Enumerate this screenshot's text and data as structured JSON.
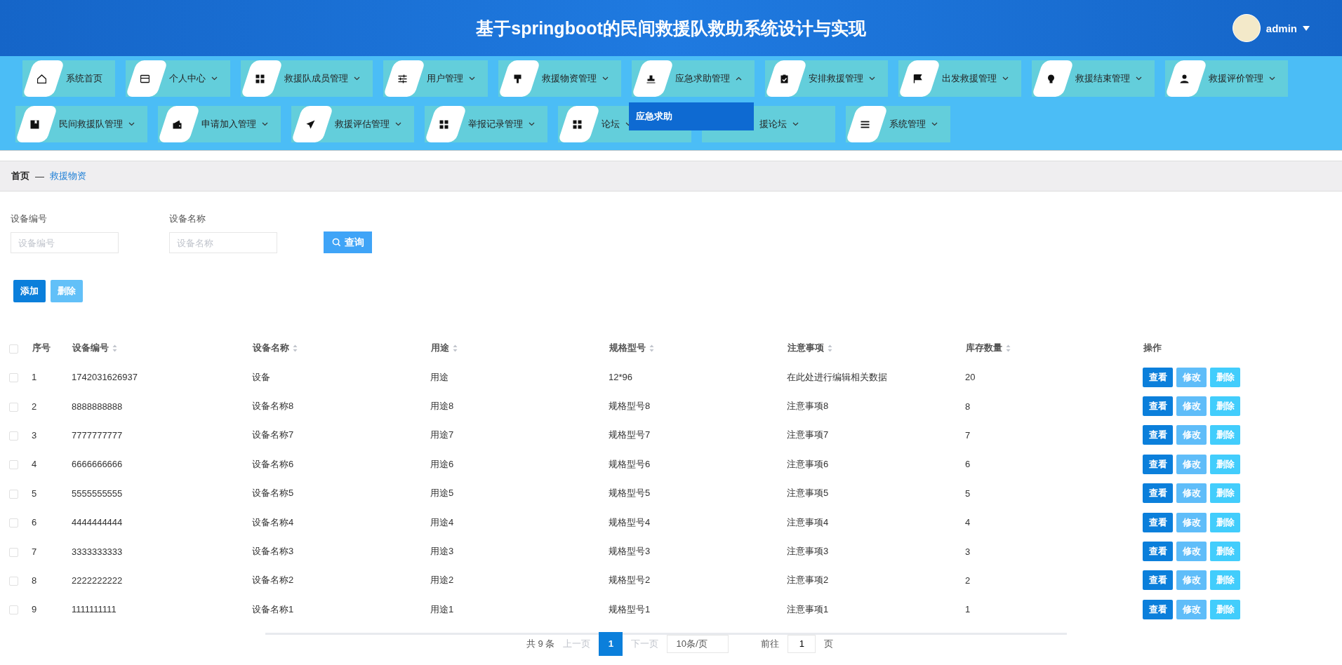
{
  "header": {
    "title": "基于springboot的民间救援队救助系统设计与实现",
    "user": "admin"
  },
  "nav": [
    {
      "label": "系统首页",
      "kind": "link"
    },
    {
      "label": "个人中心",
      "kind": "menu",
      "expanded": false
    },
    {
      "label": "救援队成员管理",
      "kind": "menu",
      "expanded": false
    },
    {
      "label": "用户管理",
      "kind": "menu",
      "expanded": false
    },
    {
      "label": "救援物资管理",
      "kind": "menu",
      "expanded": false
    },
    {
      "label": "应急求助管理",
      "kind": "menu",
      "expanded": true,
      "submenu": [
        "应急求助"
      ]
    },
    {
      "label": "安排救援管理",
      "kind": "menu",
      "expanded": false
    },
    {
      "label": "出发救援管理",
      "kind": "menu",
      "expanded": false
    },
    {
      "label": "救援结束管理",
      "kind": "menu",
      "expanded": false
    },
    {
      "label": "救援评价管理",
      "kind": "menu",
      "expanded": false
    },
    {
      "label": "民间救援队管理",
      "kind": "menu",
      "expanded": false
    },
    {
      "label": "申请加入管理",
      "kind": "menu",
      "expanded": false
    },
    {
      "label": "救援评估管理",
      "kind": "menu",
      "expanded": false
    },
    {
      "label": "举报记录管理",
      "kind": "menu",
      "expanded": false
    },
    {
      "label": "论坛",
      "kind": "menu",
      "expanded": false
    },
    {
      "label": "援论坛",
      "kind": "menu",
      "expanded": false
    },
    {
      "label": "系统管理",
      "kind": "menu",
      "expanded": false
    }
  ],
  "breadcrumb": [
    "首页",
    "—",
    "救援物资"
  ],
  "search": {
    "fields": [
      {
        "label": "设备编号",
        "placeholder": "设备编号"
      },
      {
        "label": "设备名称",
        "placeholder": "设备名称"
      }
    ],
    "button": "查询"
  },
  "actions": [
    "添加",
    "删除"
  ],
  "table": {
    "all_checked": false,
    "columns": [
      "序号",
      "设备编号",
      "设备名称",
      "用途",
      "规格型号",
      "注意事项",
      "库存数量",
      "操作"
    ],
    "rows": [
      {
        "checked": false,
        "cells": [
          "1",
          "1742031626937",
          "设备",
          "用途",
          "12*96",
          "在此处进行编辑相关数据",
          "20"
        ],
        "buttons": [
          "查看",
          "修改",
          "删除"
        ]
      },
      {
        "checked": false,
        "cells": [
          "2",
          "8888888888",
          "设备名称8",
          "用途8",
          "规格型号8",
          "注意事项8",
          "8"
        ],
        "buttons": [
          "查看",
          "修改",
          "删除"
        ]
      },
      {
        "checked": false,
        "cells": [
          "3",
          "7777777777",
          "设备名称7",
          "用途7",
          "规格型号7",
          "注意事项7",
          "7"
        ],
        "buttons": [
          "查看",
          "修改",
          "删除"
        ]
      },
      {
        "checked": false,
        "cells": [
          "4",
          "6666666666",
          "设备名称6",
          "用途6",
          "规格型号6",
          "注意事项6",
          "6"
        ],
        "buttons": [
          "查看",
          "修改",
          "删除"
        ]
      },
      {
        "checked": false,
        "cells": [
          "5",
          "5555555555",
          "设备名称5",
          "用途5",
          "规格型号5",
          "注意事项5",
          "5"
        ],
        "buttons": [
          "查看",
          "修改",
          "删除"
        ]
      },
      {
        "checked": false,
        "cells": [
          "6",
          "4444444444",
          "设备名称4",
          "用途4",
          "规格型号4",
          "注意事项4",
          "4"
        ],
        "buttons": [
          "查看",
          "修改",
          "删除"
        ]
      },
      {
        "checked": false,
        "cells": [
          "7",
          "3333333333",
          "设备名称3",
          "用途3",
          "规格型号3",
          "注意事项3",
          "3"
        ],
        "buttons": [
          "查看",
          "修改",
          "删除"
        ]
      },
      {
        "checked": false,
        "cells": [
          "8",
          "2222222222",
          "设备名称2",
          "用途2",
          "规格型号2",
          "注意事项2",
          "2"
        ],
        "buttons": [
          "查看",
          "修改",
          "删除"
        ]
      },
      {
        "checked": false,
        "cells": [
          "9",
          "1111111111",
          "设备名称1",
          "用途1",
          "规格型号1",
          "注意事项1",
          "1"
        ],
        "buttons": [
          "查看",
          "修改",
          "删除"
        ]
      }
    ]
  },
  "pagination": {
    "total": "共 9 条",
    "prev": "上一页",
    "pages": [
      {
        "label": "1",
        "selected": true
      }
    ],
    "next": "下一页",
    "page_size": "10条/页",
    "goto": "前往",
    "goto_value": "1",
    "page_unit": "页"
  }
}
